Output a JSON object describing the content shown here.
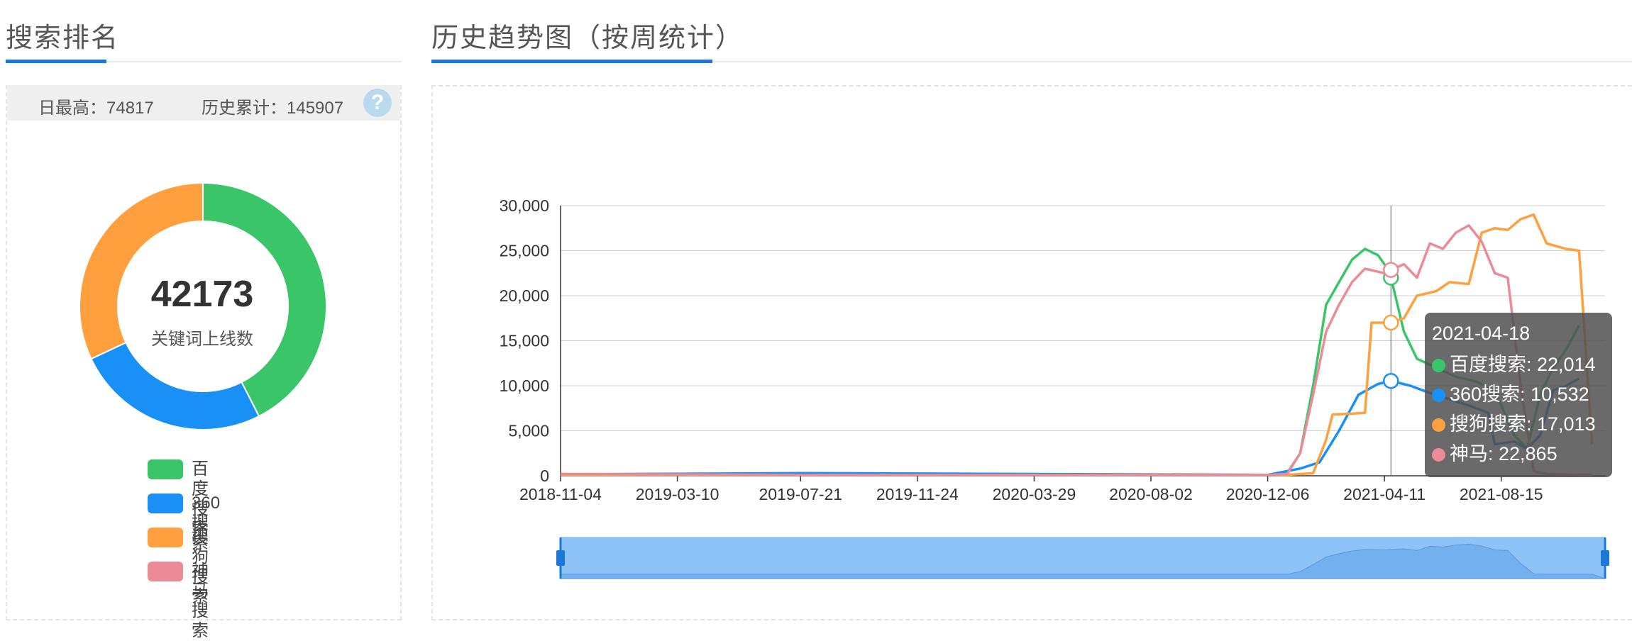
{
  "left": {
    "title": "搜索排名",
    "stats": {
      "daily_max": "日最高：74817",
      "total": "历史累计：145907"
    },
    "help_icon": "question-icon",
    "center": {
      "value": "42173",
      "label": "关键词上线数"
    },
    "legend": [
      {
        "name": "百度搜索",
        "color": "#3ac569"
      },
      {
        "name": "360搜索",
        "color": "#1890f5"
      },
      {
        "name": "搜狗搜索",
        "color": "#ff9f3e"
      },
      {
        "name": "神马搜索",
        "color": "#ec8b98"
      }
    ]
  },
  "right": {
    "title": "历史趋势图（按周统计）"
  },
  "tooltip": {
    "date": "2021-04-18",
    "rows": [
      {
        "label": "百度搜索: 22,014",
        "color": "#3ac569"
      },
      {
        "label": "360搜索: 10,532",
        "color": "#1890f5"
      },
      {
        "label": "搜狗搜索: 17,013",
        "color": "#ff9f3e"
      },
      {
        "label": "神马: 22,865",
        "color": "#ec8b98"
      }
    ]
  },
  "chart_data": [
    {
      "type": "pie",
      "subtype": "donut",
      "title": "",
      "slices": [
        {
          "name": "百度搜索",
          "value": 42.5,
          "color": "#3ac569"
        },
        {
          "name": "360搜索",
          "value": 25.5,
          "color": "#1890f5"
        },
        {
          "name": "搜狗搜索",
          "value": 32.0,
          "color": "#ff9f3e"
        },
        {
          "name": "神马搜索",
          "value": 0.0,
          "color": "#ec8b98"
        }
      ],
      "center_text": "42173",
      "center_subtext": "关键词上线数"
    },
    {
      "type": "line",
      "title": "",
      "xlabel": "",
      "ylabel": "",
      "ylim": [
        0,
        30000
      ],
      "yticks": [
        0,
        5000,
        10000,
        15000,
        20000,
        25000,
        30000
      ],
      "ytick_labels": [
        "0",
        "5,000",
        "10,000",
        "15,000",
        "20,000",
        "25,000",
        "30,000"
      ],
      "xlim": [
        "2018-11-04",
        "2021-12-05"
      ],
      "xticks": [
        "2018-11-04",
        "2019-03-10",
        "2019-07-21",
        "2019-11-24",
        "2020-03-29",
        "2020-08-02",
        "2020-12-06",
        "2021-04-11",
        "2021-08-15"
      ],
      "grid": true,
      "crosshair_x": "2021-04-18",
      "series": [
        {
          "name": "百度搜索",
          "color": "#3ac569",
          "points": [
            [
              "2018-11-04",
              200
            ],
            [
              "2020-12-06",
              100
            ],
            [
              "2020-12-27",
              300
            ],
            [
              "2021-01-10",
              2500
            ],
            [
              "2021-01-24",
              10000
            ],
            [
              "2021-02-07",
              19000
            ],
            [
              "2021-02-21",
              21500
            ],
            [
              "2021-03-07",
              24000
            ],
            [
              "2021-03-21",
              25200
            ],
            [
              "2021-04-04",
              24500
            ],
            [
              "2021-04-11",
              23500
            ],
            [
              "2021-04-18",
              22014
            ],
            [
              "2021-05-02",
              16000
            ],
            [
              "2021-05-16",
              13000
            ],
            [
              "2021-06-06",
              12000
            ],
            [
              "2021-06-27",
              11000
            ],
            [
              "2021-07-18",
              10500
            ],
            [
              "2021-08-08",
              9500
            ],
            [
              "2021-08-29",
              4500
            ],
            [
              "2021-09-12",
              3000
            ],
            [
              "2021-09-26",
              9000
            ],
            [
              "2021-10-10",
              12000
            ],
            [
              "2021-10-24",
              14000
            ],
            [
              "2021-11-07",
              16700
            ]
          ]
        },
        {
          "name": "360搜索",
          "color": "#1890f5",
          "points": [
            [
              "2018-11-04",
              150
            ],
            [
              "2019-07-21",
              300
            ],
            [
              "2020-12-06",
              100
            ],
            [
              "2021-01-10",
              800
            ],
            [
              "2021-01-31",
              1500
            ],
            [
              "2021-02-21",
              5000
            ],
            [
              "2021-03-14",
              9000
            ],
            [
              "2021-04-04",
              10200
            ],
            [
              "2021-04-18",
              10532
            ],
            [
              "2021-05-09",
              10000
            ],
            [
              "2021-05-30",
              9200
            ],
            [
              "2021-06-20",
              8500
            ],
            [
              "2021-07-11",
              7800
            ],
            [
              "2021-08-01",
              7000
            ],
            [
              "2021-08-08",
              3500
            ],
            [
              "2021-08-29",
              3800
            ],
            [
              "2021-09-12",
              3000
            ],
            [
              "2021-09-26",
              4500
            ],
            [
              "2021-10-10",
              9500
            ],
            [
              "2021-10-24",
              10000
            ],
            [
              "2021-11-07",
              10800
            ]
          ]
        },
        {
          "name": "搜狗搜索",
          "color": "#ff9f3e",
          "points": [
            [
              "2018-11-04",
              100
            ],
            [
              "2020-12-27",
              100
            ],
            [
              "2021-01-24",
              300
            ],
            [
              "2021-02-07",
              4000
            ],
            [
              "2021-02-14",
              6800
            ],
            [
              "2021-03-07",
              6900
            ],
            [
              "2021-03-21",
              7000
            ],
            [
              "2021-03-28",
              17000
            ],
            [
              "2021-04-18",
              17013
            ],
            [
              "2021-05-02",
              17500
            ],
            [
              "2021-05-16",
              20000
            ],
            [
              "2021-06-06",
              20500
            ],
            [
              "2021-06-20",
              21500
            ],
            [
              "2021-07-11",
              21300
            ],
            [
              "2021-07-25",
              27000
            ],
            [
              "2021-08-08",
              27500
            ],
            [
              "2021-08-22",
              27300
            ],
            [
              "2021-09-05",
              28500
            ],
            [
              "2021-09-19",
              29000
            ],
            [
              "2021-10-03",
              25800
            ],
            [
              "2021-10-24",
              25200
            ],
            [
              "2021-11-07",
              25000
            ],
            [
              "2021-11-21",
              3500
            ]
          ]
        },
        {
          "name": "神马搜索",
          "color": "#ec8b98",
          "points": [
            [
              "2018-11-04",
              200
            ],
            [
              "2019-07-21",
              100
            ],
            [
              "2020-12-06",
              100
            ],
            [
              "2020-12-27",
              200
            ],
            [
              "2021-01-10",
              2500
            ],
            [
              "2021-01-24",
              9000
            ],
            [
              "2021-02-07",
              16000
            ],
            [
              "2021-02-21",
              19000
            ],
            [
              "2021-03-07",
              21500
            ],
            [
              "2021-03-21",
              23000
            ],
            [
              "2021-04-11",
              22500
            ],
            [
              "2021-04-18",
              22865
            ],
            [
              "2021-05-02",
              23500
            ],
            [
              "2021-05-16",
              22000
            ],
            [
              "2021-05-30",
              25800
            ],
            [
              "2021-06-13",
              25200
            ],
            [
              "2021-06-27",
              27000
            ],
            [
              "2021-07-11",
              27800
            ],
            [
              "2021-07-25",
              26000
            ],
            [
              "2021-08-08",
              22500
            ],
            [
              "2021-08-22",
              22000
            ],
            [
              "2021-09-05",
              10000
            ],
            [
              "2021-09-19",
              500
            ],
            [
              "2021-10-03",
              200
            ],
            [
              "2021-11-21",
              100
            ]
          ]
        }
      ],
      "range_slider": {
        "start": 0,
        "end": 1
      }
    }
  ]
}
